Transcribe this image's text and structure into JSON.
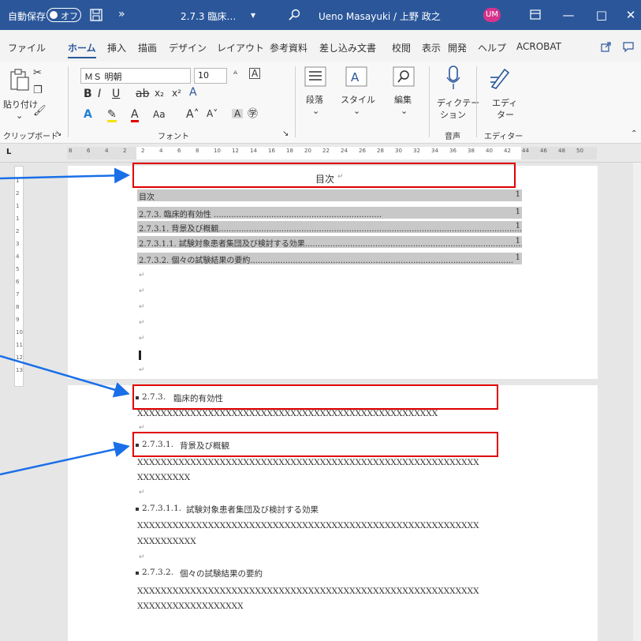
{
  "titlebar": {
    "autosave_label": "自動保存",
    "autosave_state": "オフ",
    "save_icon": "save-icon",
    "more_glyph": "»",
    "doc_title": "2.7.3 臨床…",
    "title_dropdown": "▾",
    "search_icon": "search-icon",
    "user_name": "Ueno Masayuki / 上野 政之",
    "user_initials": "UM",
    "ribbon_display_icon": "ribbon-display-icon",
    "minimize": "—",
    "maximize": "□",
    "close": "✕",
    "bg_color": "#2b579a"
  },
  "tabs": {
    "items": [
      "ファイル",
      "ホーム",
      "挿入",
      "描画",
      "デザイン",
      "レイアウト",
      "参考資料",
      "差し込み文書",
      "校閲",
      "表示",
      "開発",
      "ヘルプ",
      "ACROBAT"
    ],
    "active": "ホーム",
    "share_icon": "share-icon",
    "comment_icon": "comment-icon"
  },
  "ribbon": {
    "paste_label": "貼り付け",
    "clipboard_group": "クリップボード",
    "font_name": "ＭＳ 明朝",
    "font_size": "10",
    "font_group": "フォント",
    "bold": "B",
    "italic": "I",
    "underline": "U",
    "strike": "ab",
    "subscript": "x₂",
    "superscript": "x²",
    "case_label": "Aa",
    "grow_label": "A˄",
    "shrink_label": "A˅",
    "paragraph_label": "段落",
    "style_label": "スタイル",
    "edit_label": "編集",
    "dictate_label_1": "ディクテー",
    "dictate_label_2": "ション",
    "voice_group": "音声",
    "editor_label_1": "エディ",
    "editor_label_2": "ター",
    "editor_group": "エディター",
    "dialog_launcher": "↘"
  },
  "ruler": {
    "marks": [
      "8",
      "6",
      "4",
      "2",
      "2",
      "4",
      "6",
      "8",
      "10",
      "12",
      "14",
      "16",
      "18",
      "20",
      "22",
      "24",
      "26",
      "28",
      "30",
      "32",
      "34",
      "36",
      "38",
      "40",
      "42",
      "44",
      "46",
      "48",
      "50"
    ],
    "corner_label": "L"
  },
  "vruler": {
    "marks": [
      "1",
      "2",
      "1",
      "1",
      "2",
      "3",
      "4",
      "5",
      "6",
      "7",
      "8",
      "9",
      "10",
      "11",
      "12",
      "13"
    ]
  },
  "document": {
    "toc_title": "目次",
    "paragraph_mark": "↵",
    "toc_entries": [
      {
        "text": "目次",
        "page": "1"
      },
      {
        "text": "2.7.3. 臨床的有効性 ...................................................................",
        "page": "1"
      },
      {
        "text": "2.7.3.1. 背景及び概観.........................................................................................................................",
        "page": "1"
      },
      {
        "text": "2.7.3.1.1. 試験対象患者集団及び検討する効果...........................................................................................",
        "page": "1"
      },
      {
        "text": "2.7.3.2. 個々の試験結果の要約.........................................................................................................",
        "page": "1"
      }
    ],
    "headings": [
      {
        "number": "2.7.3.",
        "title": "臨床的有効性",
        "body": [
          "XXXXXXXXXXXXXXXXXXXXXXXXXXXXXXXXXXXXXXXXXXXXXXXXXXX"
        ]
      },
      {
        "number": "2.7.3.1.",
        "title": "背景及び概観",
        "body": [
          "XXXXXXXXXXXXXXXXXXXXXXXXXXXXXXXXXXXXXXXXXXXXXXXXXXXXXXXXXX",
          "XXXXXXXXX"
        ]
      },
      {
        "number": "2.7.3.1.1.",
        "title": "試験対象患者集団及び検討する効果",
        "body": [
          "XXXXXXXXXXXXXXXXXXXXXXXXXXXXXXXXXXXXXXXXXXXXXXXXXXXXXXXXXX",
          "XXXXXXXXXX"
        ]
      },
      {
        "number": "2.7.3.2.",
        "title": "個々の試験結果の要約",
        "body": [
          "XXXXXXXXXXXXXXXXXXXXXXXXXXXXXXXXXXXXXXXXXXXXXXXXXXXXXXXXXX",
          "XXXXXXXXXXXXXXXXXX"
        ]
      }
    ]
  },
  "annotations": {
    "highlight_color": "#e00000",
    "arrow_color": "#1a6fe8"
  }
}
